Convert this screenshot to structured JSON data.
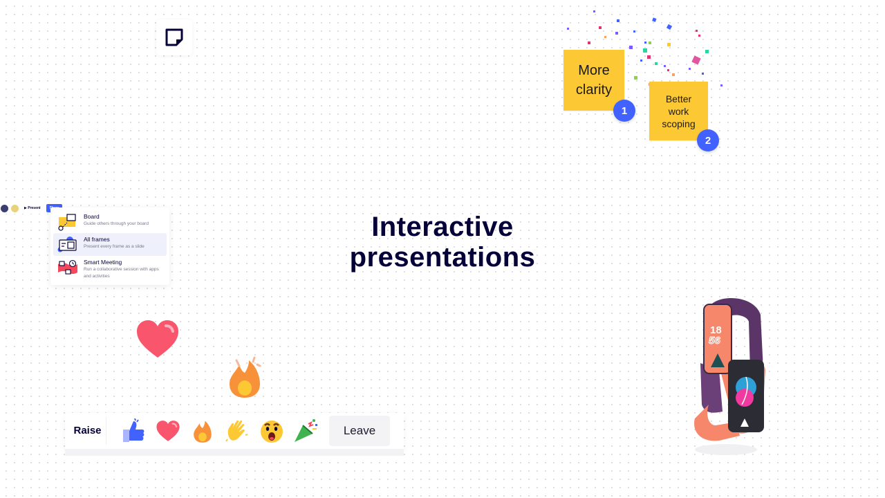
{
  "canvas": {
    "sticky_tool": {
      "icon": "sticky-note-icon"
    }
  },
  "stickies": [
    {
      "text_lines": [
        "More",
        "clarity"
      ],
      "color": "#fcc834",
      "votes": "1"
    },
    {
      "text_lines": [
        "Better",
        "work",
        "scoping"
      ],
      "color": "#fcc834",
      "votes": "2"
    }
  ],
  "hero": {
    "line1": "Interactive",
    "line2": "presentations"
  },
  "mini_toolbar": {
    "present_label": "▶ Present",
    "share_label": "Share",
    "share_color": "#4262ff"
  },
  "present_menu": {
    "items": [
      {
        "title": "Board",
        "description": "Guide others through your board",
        "icon": "board-icon",
        "selected": false
      },
      {
        "title": "All frames",
        "description": "Present every frame as a slide",
        "icon": "frames-icon",
        "selected": true
      },
      {
        "title": "Smart Meeting",
        "description": "Run a collaborative session with apps and activities",
        "icon": "meeting-icon",
        "selected": false
      }
    ]
  },
  "floating_reactions": [
    "heart-icon",
    "fire-icon"
  ],
  "reaction_bar": {
    "raise_label": "Raise",
    "reactions": [
      "thumbs-up",
      "heart",
      "fire",
      "wave",
      "surprised",
      "party-popper"
    ],
    "leave_label": "Leave"
  },
  "colors": {
    "brand_blue": "#4262ff",
    "sticky_yellow": "#fcc834",
    "title_navy": "#050038"
  }
}
